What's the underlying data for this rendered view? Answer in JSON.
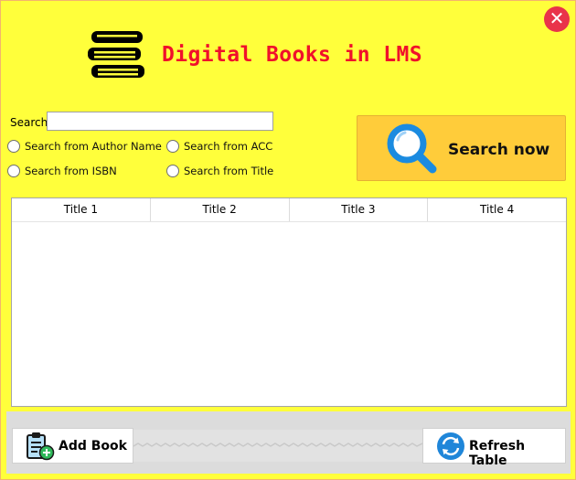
{
  "window": {
    "title": "Digital Books in LMS",
    "close_symbol": "✕",
    "logo_icon": "books-stack-icon"
  },
  "search": {
    "label": "Search",
    "value": "",
    "placeholder": "",
    "options": [
      {
        "label": "Search from Author Name",
        "selected": false
      },
      {
        "label": "Search from ACC",
        "selected": false
      },
      {
        "label": "Search from ISBN",
        "selected": false
      },
      {
        "label": "Search from Title",
        "selected": false
      }
    ],
    "button_label": "Search now",
    "button_icon": "magnifier-icon"
  },
  "table": {
    "columns": [
      "Title 1",
      "Title 2",
      "Title 3",
      "Title 4"
    ],
    "rows": []
  },
  "footer": {
    "add_book_label": "Add Book",
    "add_book_icon": "clipboard-add-icon",
    "refresh_label": "Refresh Table",
    "refresh_icon": "refresh-icon"
  },
  "colors": {
    "background": "#ffff3b",
    "title": "#f0102b",
    "search_button": "#ffcc3a",
    "close_button": "#e9334a"
  }
}
